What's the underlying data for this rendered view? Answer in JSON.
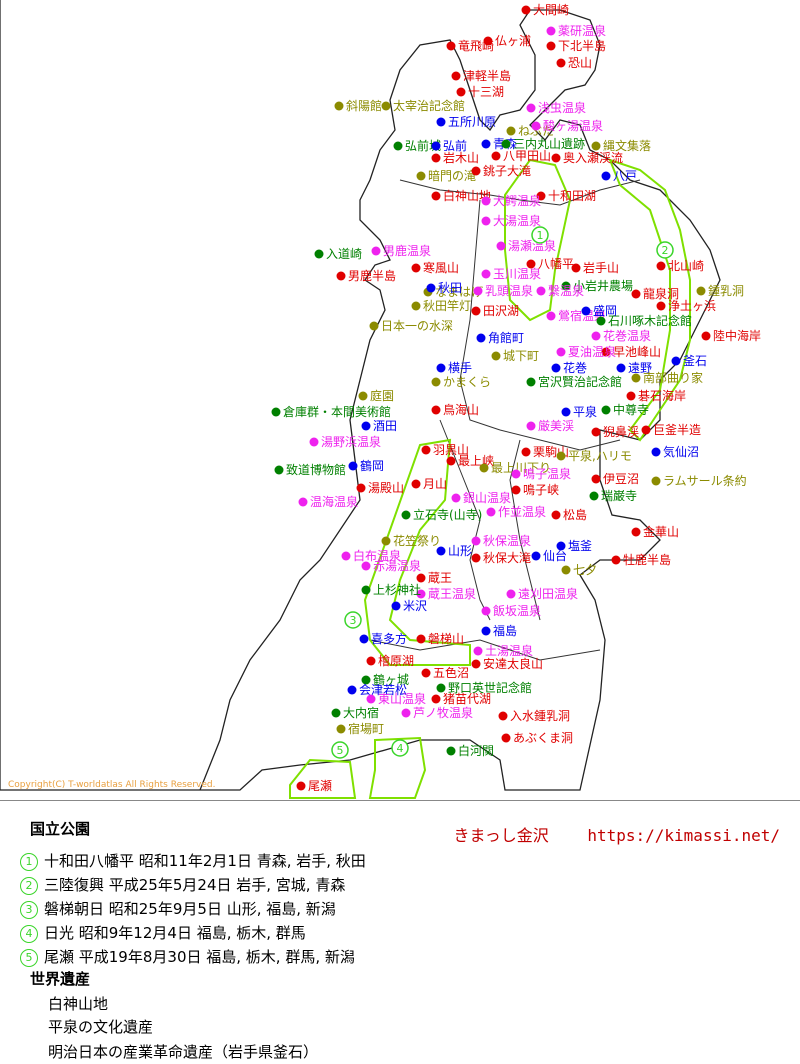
{
  "copyright": "Copyright(C) T-worldatlas All Rights Reserved.",
  "site_name": "きまっし金沢",
  "site_url": "https://kimassi.net/",
  "parks_title": "国立公園",
  "heritage_title": "世界遺産",
  "parks": [
    {
      "num": "1",
      "text": "十和田八幡平 昭和11年2月1日 青森, 岩手, 秋田"
    },
    {
      "num": "2",
      "text": "三陸復興 平成25年5月24日 岩手, 宮城, 青森"
    },
    {
      "num": "3",
      "text": "磐梯朝日 昭和25年9月5日 山形, 福島, 新潟"
    },
    {
      "num": "4",
      "text": "日光 昭和9年12月4日 福島, 栃木, 群馬"
    },
    {
      "num": "5",
      "text": "尾瀬 平成19年8月30日 福島, 栃木, 群馬, 新潟"
    }
  ],
  "heritage": [
    "白神山地",
    "平泉の文化遺産",
    "明治日本の産業革命遺産（岩手県釜石）"
  ],
  "colors": {
    "mountain": "#e00000",
    "onsen": "#ee22ee",
    "city": "#0000ee",
    "culture": "#008000",
    "sight": "#8b8b00",
    "park_line": "#3ad52a"
  },
  "places": [
    {
      "name": "大間崎",
      "cat": "mountain"
    },
    {
      "name": "薬研温泉",
      "cat": "onsen"
    },
    {
      "name": "仏ヶ浦",
      "cat": "mountain"
    },
    {
      "name": "下北半島",
      "cat": "mountain"
    },
    {
      "name": "竜飛崎",
      "cat": "mountain"
    },
    {
      "name": "恐山",
      "cat": "mountain"
    },
    {
      "name": "津軽半島",
      "cat": "mountain"
    },
    {
      "name": "十三湖",
      "cat": "mountain"
    },
    {
      "name": "斜陽館",
      "cat": "sight"
    },
    {
      "name": "太宰治記念館",
      "cat": "sight"
    },
    {
      "name": "浅虫温泉",
      "cat": "onsen"
    },
    {
      "name": "五所川原",
      "cat": "city"
    },
    {
      "name": "ねぶた",
      "cat": "sight"
    },
    {
      "name": "酸ヶ湯温泉",
      "cat": "onsen"
    },
    {
      "name": "弘前城",
      "cat": "culture"
    },
    {
      "name": "弘前",
      "cat": "city"
    },
    {
      "name": "青森",
      "cat": "city"
    },
    {
      "name": "三内丸山遺跡",
      "cat": "culture"
    },
    {
      "name": "縄文集落",
      "cat": "sight"
    },
    {
      "name": "岩木山",
      "cat": "mountain"
    },
    {
      "name": "八甲田山",
      "cat": "mountain"
    },
    {
      "name": "奥入瀬渓流",
      "cat": "mountain"
    },
    {
      "name": "暗門の滝",
      "cat": "sight"
    },
    {
      "name": "銚子大滝",
      "cat": "mountain"
    },
    {
      "name": "八戸",
      "cat": "city"
    },
    {
      "name": "白神山地",
      "cat": "mountain"
    },
    {
      "name": "十和田湖",
      "cat": "mountain"
    },
    {
      "name": "大鰐温泉",
      "cat": "onsen"
    },
    {
      "name": "大湯温泉",
      "cat": "onsen"
    },
    {
      "name": "湯瀬温泉",
      "cat": "onsen"
    },
    {
      "name": "入道崎",
      "cat": "culture"
    },
    {
      "name": "男鹿温泉",
      "cat": "onsen"
    },
    {
      "name": "男鹿半島",
      "cat": "mountain"
    },
    {
      "name": "寒風山",
      "cat": "mountain"
    },
    {
      "name": "八幡平",
      "cat": "mountain"
    },
    {
      "name": "岩手山",
      "cat": "mountain"
    },
    {
      "name": "北山崎",
      "cat": "mountain"
    },
    {
      "name": "なまはげ",
      "cat": "sight"
    },
    {
      "name": "玉川温泉",
      "cat": "onsen"
    },
    {
      "name": "小岩井農場",
      "cat": "culture"
    },
    {
      "name": "龍泉洞",
      "cat": "mountain"
    },
    {
      "name": "鍾乳洞",
      "cat": "sight"
    },
    {
      "name": "秋田",
      "cat": "city"
    },
    {
      "name": "乳頭温泉",
      "cat": "onsen"
    },
    {
      "name": "繋温泉",
      "cat": "onsen"
    },
    {
      "name": "浄土ヶ浜",
      "cat": "mountain"
    },
    {
      "name": "秋田竿灯",
      "cat": "sight"
    },
    {
      "name": "田沢湖",
      "cat": "mountain"
    },
    {
      "name": "鶯宿温泉",
      "cat": "onsen"
    },
    {
      "name": "盛岡",
      "cat": "city"
    },
    {
      "name": "日本一の水深",
      "cat": "sight"
    },
    {
      "name": "石川啄木記念館",
      "cat": "culture"
    },
    {
      "name": "花巻温泉",
      "cat": "onsen"
    },
    {
      "name": "陸中海岸",
      "cat": "mountain"
    },
    {
      "name": "角館町",
      "cat": "city"
    },
    {
      "name": "早池峰山",
      "cat": "mountain"
    },
    {
      "name": "夏油温泉",
      "cat": "onsen"
    },
    {
      "name": "城下町",
      "cat": "sight"
    },
    {
      "name": "横手",
      "cat": "city"
    },
    {
      "name": "花巻",
      "cat": "city"
    },
    {
      "name": "遠野",
      "cat": "city"
    },
    {
      "name": "釜石",
      "cat": "city"
    },
    {
      "name": "南部曲り家",
      "cat": "sight"
    },
    {
      "name": "かまくら",
      "cat": "sight"
    },
    {
      "name": "宮沢賢治記念館",
      "cat": "culture"
    },
    {
      "name": "碁石海岸",
      "cat": "mountain"
    },
    {
      "name": "庭園",
      "cat": "sight"
    },
    {
      "name": "倉庫群・本間美術館",
      "cat": "culture"
    },
    {
      "name": "鳥海山",
      "cat": "mountain"
    },
    {
      "name": "平泉",
      "cat": "city"
    },
    {
      "name": "中尊寺",
      "cat": "culture"
    },
    {
      "name": "酒田",
      "cat": "city"
    },
    {
      "name": "厳美渓",
      "cat": "onsen"
    },
    {
      "name": "猊鼻渓",
      "cat": "mountain"
    },
    {
      "name": "巨釜半造",
      "cat": "mountain"
    },
    {
      "name": "湯野浜温泉",
      "cat": "onsen"
    },
    {
      "name": "栗駒山",
      "cat": "mountain"
    },
    {
      "name": "平泉,ハリモ",
      "cat": "sight"
    },
    {
      "name": "気仙沼",
      "cat": "city"
    },
    {
      "name": "羽黒山",
      "cat": "mountain"
    },
    {
      "name": "最上峡",
      "cat": "mountain"
    },
    {
      "name": "致道博物館",
      "cat": "culture"
    },
    {
      "name": "鶴岡",
      "cat": "city"
    },
    {
      "name": "最上川下り",
      "cat": "sight"
    },
    {
      "name": "鳴子温泉",
      "cat": "onsen"
    },
    {
      "name": "伊豆沼",
      "cat": "mountain"
    },
    {
      "name": "ラムサール条約",
      "cat": "sight"
    },
    {
      "name": "月山",
      "cat": "mountain"
    },
    {
      "name": "湯殿山",
      "cat": "mountain"
    },
    {
      "name": "鳴子峡",
      "cat": "mountain"
    },
    {
      "name": "温海温泉",
      "cat": "onsen"
    },
    {
      "name": "銀山温泉",
      "cat": "onsen"
    },
    {
      "name": "瑞巌寺",
      "cat": "culture"
    },
    {
      "name": "立石寺(山寺)",
      "cat": "culture"
    },
    {
      "name": "作並温泉",
      "cat": "onsen"
    },
    {
      "name": "松島",
      "cat": "mountain"
    },
    {
      "name": "金華山",
      "cat": "mountain"
    },
    {
      "name": "花笠祭り",
      "cat": "sight"
    },
    {
      "name": "秋保温泉",
      "cat": "onsen"
    },
    {
      "name": "塩釜",
      "cat": "city"
    },
    {
      "name": "山形",
      "cat": "city"
    },
    {
      "name": "秋保大滝",
      "cat": "mountain"
    },
    {
      "name": "仙台",
      "cat": "city"
    },
    {
      "name": "牡鹿半島",
      "cat": "mountain"
    },
    {
      "name": "七夕",
      "cat": "sight"
    },
    {
      "name": "白布温泉",
      "cat": "onsen"
    },
    {
      "name": "赤湯温泉",
      "cat": "onsen"
    },
    {
      "name": "蔵王",
      "cat": "mountain"
    },
    {
      "name": "蔵王温泉",
      "cat": "onsen"
    },
    {
      "name": "遠刈田温泉",
      "cat": "onsen"
    },
    {
      "name": "上杉神社",
      "cat": "culture"
    },
    {
      "name": "米沢",
      "cat": "city"
    },
    {
      "name": "飯坂温泉",
      "cat": "onsen"
    },
    {
      "name": "喜多方",
      "cat": "city"
    },
    {
      "name": "磐梯山",
      "cat": "mountain"
    },
    {
      "name": "福島",
      "cat": "city"
    },
    {
      "name": "檜原湖",
      "cat": "mountain"
    },
    {
      "name": "土湯温泉",
      "cat": "onsen"
    },
    {
      "name": "五色沼",
      "cat": "mountain"
    },
    {
      "name": "安達太良山",
      "cat": "mountain"
    },
    {
      "name": "鶴ヶ城",
      "cat": "culture"
    },
    {
      "name": "会津若松",
      "cat": "city"
    },
    {
      "name": "野口英世記念館",
      "cat": "culture"
    },
    {
      "name": "猪苗代湖",
      "cat": "mountain"
    },
    {
      "name": "東山温泉",
      "cat": "onsen"
    },
    {
      "name": "芦ノ牧温泉",
      "cat": "onsen"
    },
    {
      "name": "大内宿",
      "cat": "culture"
    },
    {
      "name": "入水鍾乳洞",
      "cat": "mountain"
    },
    {
      "name": "宿場町",
      "cat": "sight"
    },
    {
      "name": "あぶくま洞",
      "cat": "mountain"
    },
    {
      "name": "白河関",
      "cat": "culture"
    },
    {
      "name": "尾瀬",
      "cat": "mountain"
    }
  ]
}
